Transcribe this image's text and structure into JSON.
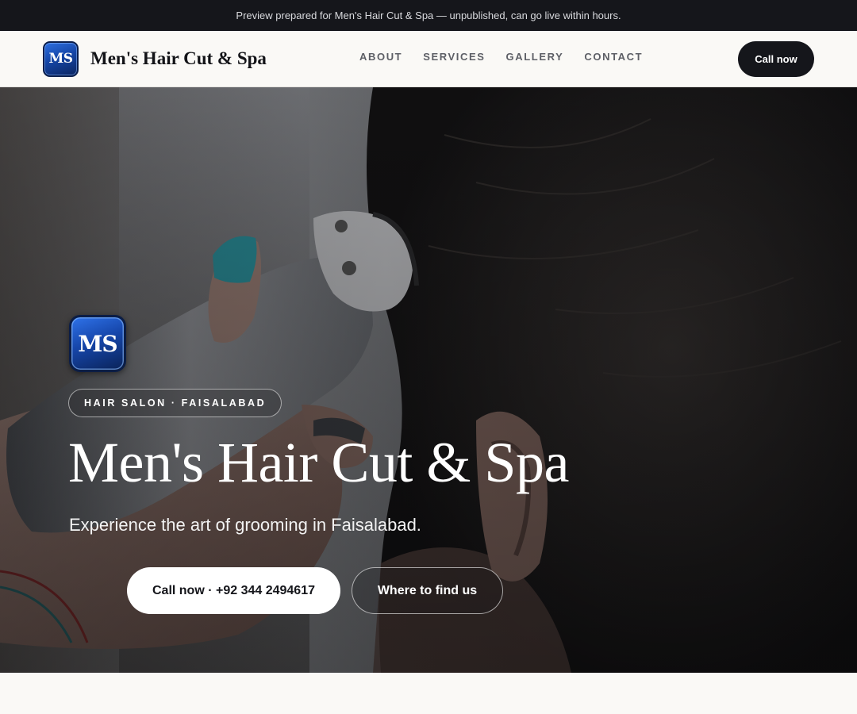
{
  "preview_bar": {
    "text": "Preview prepared for Men's Hair Cut & Spa — unpublished, can go live within hours."
  },
  "header": {
    "logo_text": "MS",
    "brand_name": "Men's Hair Cut & Spa",
    "nav": [
      {
        "label": "ABOUT"
      },
      {
        "label": "SERVICES"
      },
      {
        "label": "GALLERY"
      },
      {
        "label": "CONTACT"
      }
    ],
    "cta_label": "Call now"
  },
  "hero": {
    "logo_text": "MS",
    "tag": "HAIR SALON · FAISALABAD",
    "title": "Men's Hair Cut & Spa",
    "subtitle": "Experience the art of grooming in Faisalabad.",
    "primary_cta": "Call now · +92 344 2494617",
    "secondary_cta": "Where to find us",
    "image_description_icon": "barber-clipper-photo"
  },
  "colors": {
    "dark": "#15161b",
    "page_bg": "#faf9f6",
    "logo_blue": "#1546a8",
    "nav_text": "#5d5f66"
  }
}
